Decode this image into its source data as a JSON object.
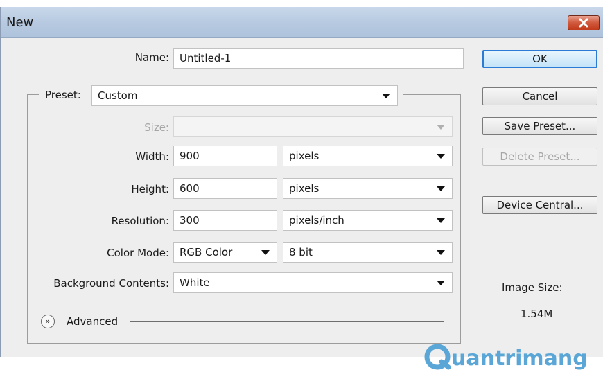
{
  "window": {
    "title": "New"
  },
  "form": {
    "name": {
      "label": "Name:",
      "value": "Untitled-1"
    },
    "preset": {
      "label": "Preset:",
      "value": "Custom"
    },
    "size": {
      "label": "Size:",
      "value": ""
    },
    "width": {
      "label": "Width:",
      "value": "900",
      "unit": "pixels"
    },
    "height": {
      "label": "Height:",
      "value": "600",
      "unit": "pixels"
    },
    "resolution": {
      "label": "Resolution:",
      "value": "300",
      "unit": "pixels/inch"
    },
    "color_mode": {
      "label": "Color Mode:",
      "value": "RGB Color",
      "depth": "8 bit"
    },
    "background": {
      "label": "Background Contents:",
      "value": "White"
    },
    "advanced": {
      "label": "Advanced"
    }
  },
  "buttons": {
    "ok": "OK",
    "cancel": "Cancel",
    "save_preset": "Save Preset...",
    "delete_preset": "Delete Preset...",
    "device_central": "Device Central..."
  },
  "image_size": {
    "label": "Image Size:",
    "value": "1.54M"
  },
  "watermark": {
    "text": "uantrimang"
  },
  "colors": {
    "titlebar": "#b6c9e0",
    "dialog_bg": "#eeeeee",
    "close_button": "#c23b1c",
    "ok_border": "#2b7bd6",
    "watermark": "#5aa6d6"
  }
}
